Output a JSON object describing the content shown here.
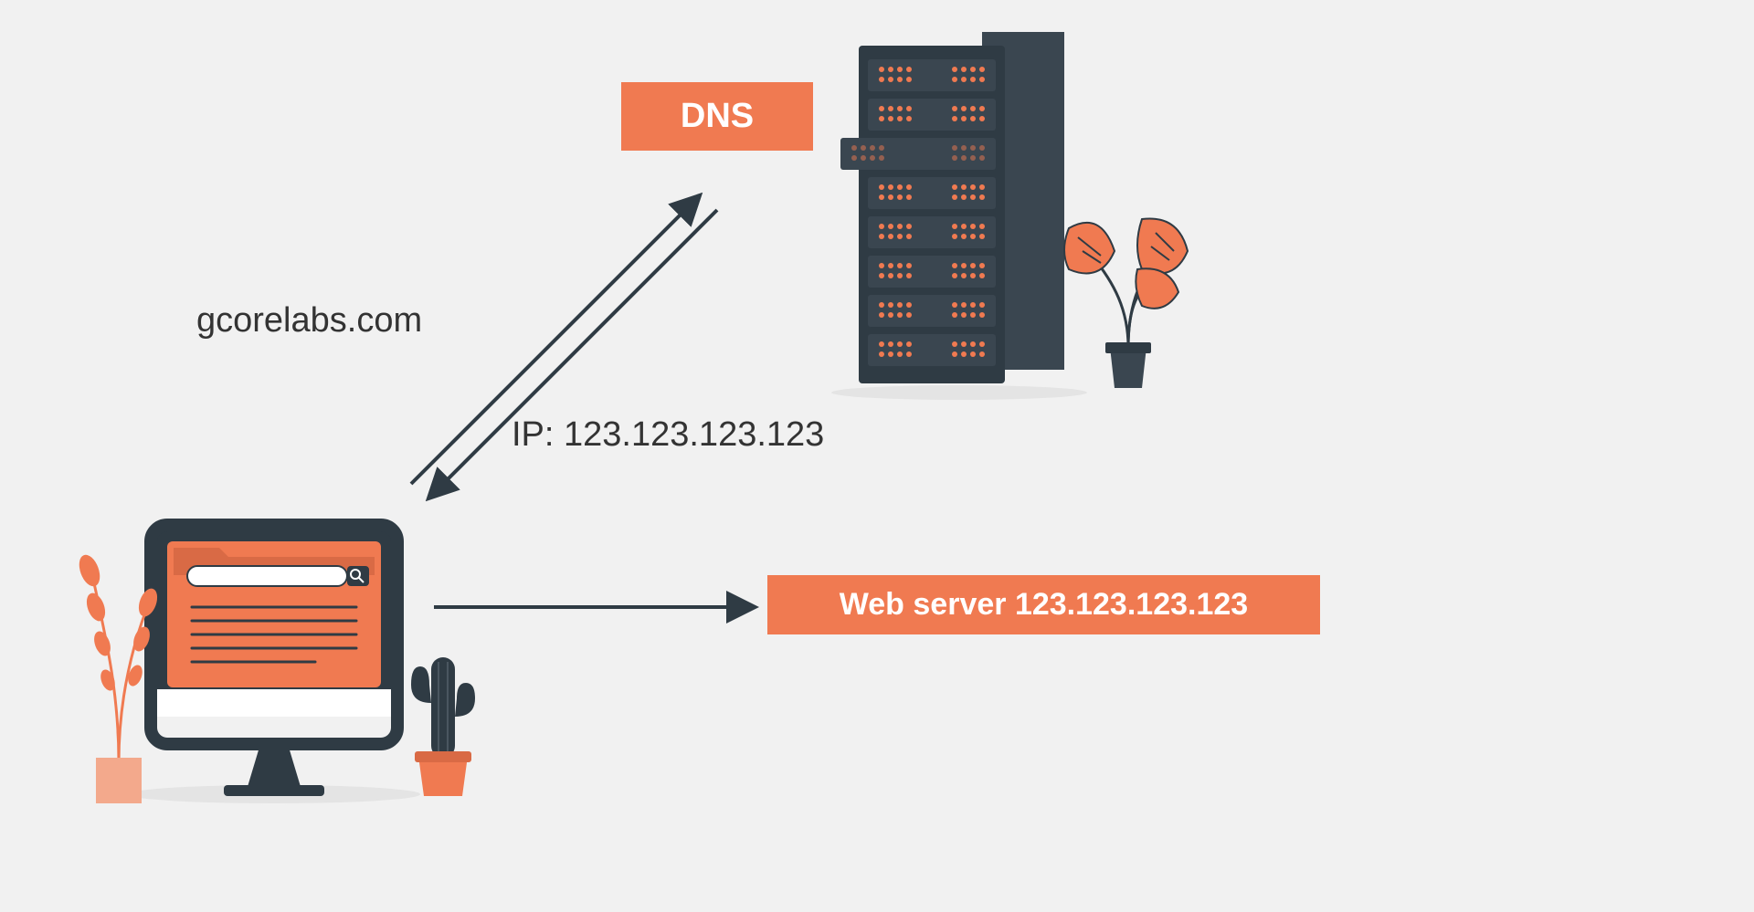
{
  "labels": {
    "dns": "DNS",
    "domain": "gcorelabs.com",
    "ip": "IP: 123.123.123.123",
    "webserver": "Web server 123.123.123.123"
  },
  "colors": {
    "accent": "#f07a51",
    "dark": "#2f3b44",
    "bg": "#f1f1f1"
  },
  "diagram": {
    "nodes": [
      "client-computer",
      "dns-server",
      "web-server"
    ],
    "edges": [
      {
        "from": "client-computer",
        "to": "dns-server",
        "label": "gcorelabs.com",
        "dir": "both"
      },
      {
        "from": "dns-server",
        "to": "client-computer",
        "label": "IP: 123.123.123.123",
        "dir": "both"
      },
      {
        "from": "client-computer",
        "to": "web-server",
        "label": "",
        "dir": "forward"
      }
    ]
  }
}
